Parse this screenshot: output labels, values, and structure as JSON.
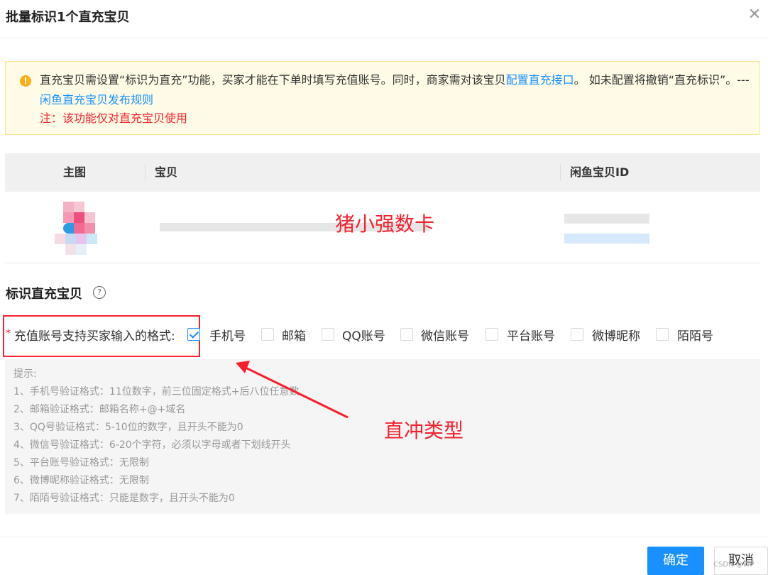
{
  "dialog": {
    "title": "批量标识1个直充宝贝",
    "close_glyph": "✕"
  },
  "notice": {
    "text_a": "直充宝贝需设置“标识为直充”功能，买家才能在下单时填写充值账号。同时，商家需对该宝贝",
    "link1": "配置直充接口",
    "text_b": "。 如未配置将撤销“直充标识”。---",
    "link2": "闲鱼直充宝贝发布规则",
    "warning_line": "注：该功能仅对直充宝贝使用",
    "icon": "warning-icon",
    "warning_color": "#f5222d"
  },
  "table": {
    "headers": [
      "主图",
      "宝贝",
      "闲鱼宝贝ID"
    ],
    "rows": [
      {
        "annotation": "猪小强数卡"
      }
    ]
  },
  "section": {
    "title": "标识直充宝贝"
  },
  "form": {
    "required_mark": "*",
    "label": "充值账号支持买家输入的格式:",
    "options": [
      {
        "label": "手机号",
        "checked": true
      },
      {
        "label": "邮箱",
        "checked": false
      },
      {
        "label": "QQ账号",
        "checked": false
      },
      {
        "label": "微信账号",
        "checked": false
      },
      {
        "label": "平台账号",
        "checked": false
      },
      {
        "label": "微博昵称",
        "checked": false
      },
      {
        "label": "陌陌号",
        "checked": false
      }
    ]
  },
  "tips": {
    "title": "提示:",
    "lines": [
      "1、手机号验证格式：11位数字，前三位固定格式+后八位任意数",
      "2、邮箱验证格式：邮箱名称+@+域名",
      "3、QQ号验证格式：5-10位的数字，且开头不能为0",
      "4、微信号验证格式：6-20个字符，必须以字母或者下划线开头",
      "5、平台账号验证格式：无限制",
      "6、微博昵称验证格式：无限制",
      "7、陌陌号验证格式：只能是数字，且开头不能为0"
    ]
  },
  "annotation": {
    "label": "直冲类型"
  },
  "buttons": {
    "ok": "确定",
    "cancel": "取消"
  },
  "watermark": "CSDN @WP"
}
